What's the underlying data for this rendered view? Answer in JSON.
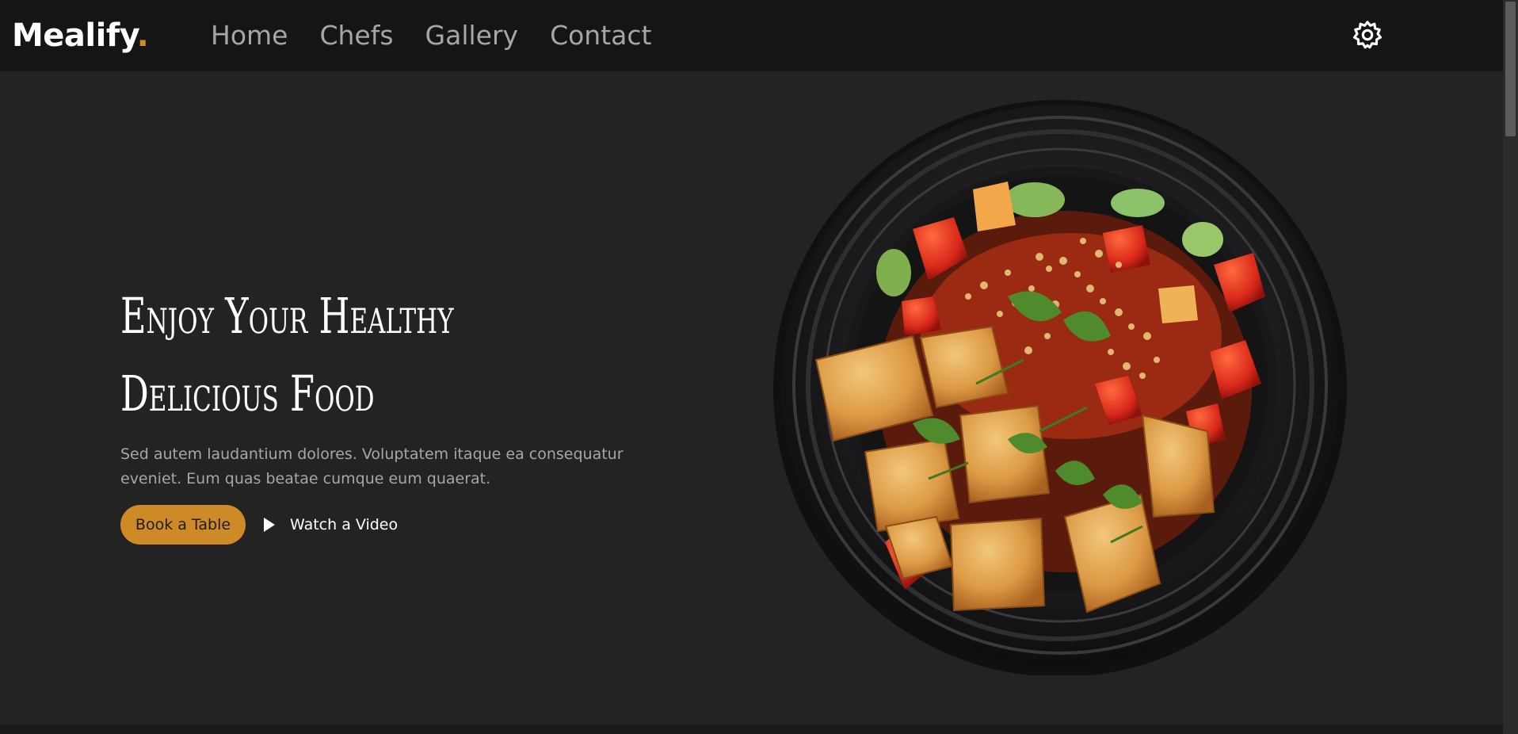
{
  "brand": {
    "name": "Mealify",
    "dot": ".",
    "accent_color": "#cd8a27"
  },
  "nav": {
    "items": [
      {
        "label": "Home"
      },
      {
        "label": "Chefs"
      },
      {
        "label": "Gallery"
      },
      {
        "label": "Contact"
      }
    ]
  },
  "header": {
    "settings_icon": "gear-icon"
  },
  "hero": {
    "title_line1": "Enjoy Your Healthy",
    "title_line2": "Delicious Food",
    "subtitle_line1": "Sed autem laudantium dolores. Voluptatem itaque ea consequatur",
    "subtitle_line2": "eveniet. Eum quas beatae cumque eum quaerat.",
    "primary_button": "Book a Table",
    "secondary_button": "Watch a Video",
    "play_icon": "play-icon",
    "image_icon": "food-plate-image"
  },
  "colors": {
    "background": "#232323",
    "header_background": "#151515",
    "button": "#cd8a27",
    "text_primary": "#ffffff",
    "text_muted": "#a7a7a7"
  }
}
